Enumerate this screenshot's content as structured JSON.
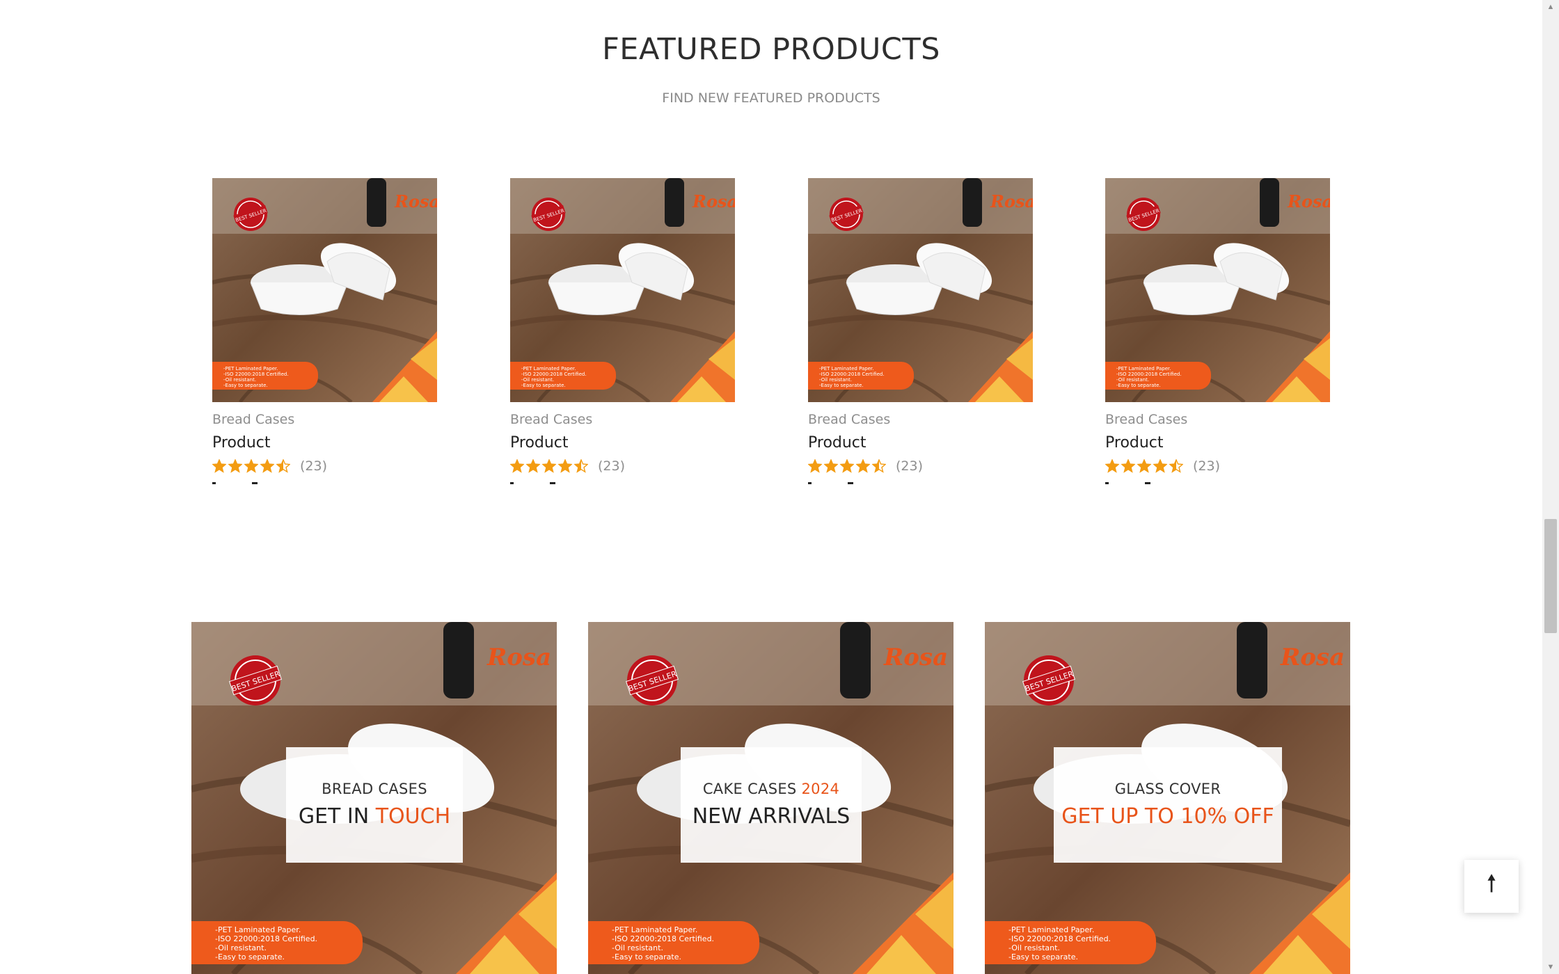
{
  "section": {
    "title": "FEATURED PRODUCTS",
    "subtitle": "FIND NEW FEATURED PRODUCTS"
  },
  "products": [
    {
      "category": "Bread Cases",
      "name": "Product",
      "rating": 4.5,
      "rating_count": "(23)"
    },
    {
      "category": "Bread Cases",
      "name": "Product",
      "rating": 4.5,
      "rating_count": "(23)"
    },
    {
      "category": "Bread Cases",
      "name": "Product",
      "rating": 4.5,
      "rating_count": "(23)"
    },
    {
      "category": "Bread Cases",
      "name": "Product",
      "rating": 4.5,
      "rating_count": "(23)"
    }
  ],
  "product_image": {
    "brand": "Rosa",
    "badge": "BEST SELLER",
    "features": [
      "-PET Laminated Paper.",
      "-ISO 22000:2018 Certified.",
      "-Oil resistant.",
      "-Easy to separate."
    ]
  },
  "banners": [
    {
      "small": "BREAD CASES",
      "small_accent": "",
      "big": "GET IN ",
      "big_accent": "TOUCH"
    },
    {
      "small": "CAKE CASES ",
      "small_accent": "2024",
      "big": "NEW ARRIVALS",
      "big_accent": ""
    },
    {
      "small": "GLASS COVER",
      "small_accent": "",
      "big": "",
      "big_accent": "GET UP TO 10% OFF"
    }
  ],
  "scroll_top": {
    "icon": "arrow-up-icon",
    "glyph": "🠕"
  },
  "colors": {
    "accent": "#e8541a",
    "star": "#f39c12"
  }
}
